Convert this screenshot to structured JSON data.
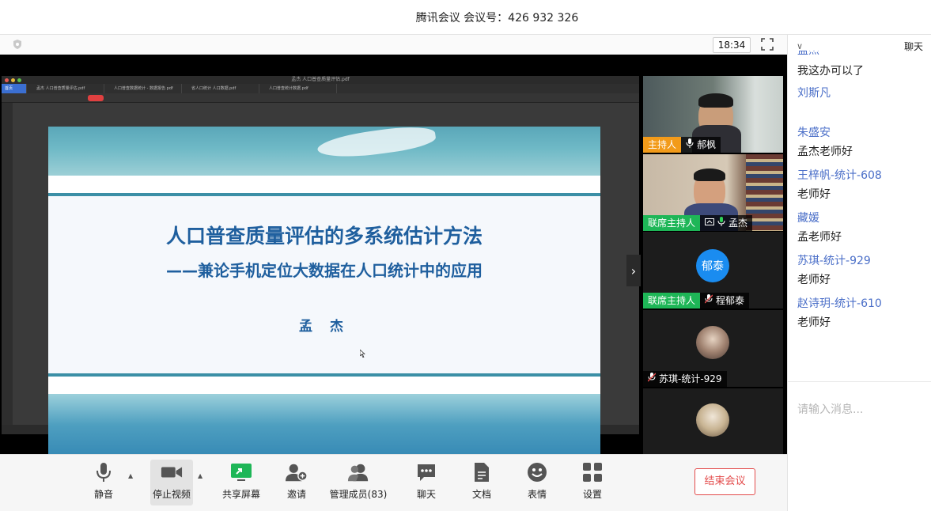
{
  "window": {
    "title": "腾讯会议  会议号：426 932 326"
  },
  "meeting": {
    "timer": "18:34"
  },
  "slide": {
    "title": "人口普查质量评估的多系统估计方法",
    "subtitle": "——兼论手机定位大数据在人口统计中的应用",
    "author": "孟 杰"
  },
  "pdf_viewer": {
    "window_title": "孟杰 人口普查质量评估.pdf",
    "tabs": [
      "首页",
      "孟杰 人口普查质量评估.pdf",
      "人口普查数据统计 - 数据报告.pdf",
      "省人口统计 人口数据.pdf",
      "人口普查统计数据.pdf"
    ]
  },
  "participants": [
    {
      "role": "主持人",
      "name": "郝枫",
      "mic": "on",
      "video": "camera"
    },
    {
      "role": "联席主持人",
      "name": "孟杰",
      "mic": "on",
      "sharing": true,
      "video": "camera"
    },
    {
      "role": "联席主持人",
      "name": "程郁泰",
      "mic": "muted",
      "avatar_text": "郁泰",
      "avatar_color": "#1a8cf0"
    },
    {
      "role": "",
      "name": "苏琪-统计-929",
      "mic": "muted",
      "video": "avatar-photo"
    },
    {
      "role": "",
      "name": "",
      "mic": "",
      "video": "avatar-photo"
    }
  ],
  "toolbar": {
    "mute": "静音",
    "stop_video": "停止视频",
    "share_screen": "共享屏幕",
    "invite": "邀请",
    "manage_members": "管理成员(83)",
    "chat": "聊天",
    "documents": "文档",
    "reactions": "表情",
    "settings": "设置",
    "end_meeting": "结束会议"
  },
  "chat": {
    "header": "聊天",
    "messages": [
      {
        "name": "孟杰",
        "text": "我这办可以了"
      },
      {
        "name": "刘斯凡",
        "text": ""
      },
      {
        "name": "朱盛安",
        "text": "孟杰老师好"
      },
      {
        "name": "王梓帆-统计-608",
        "text": "老师好"
      },
      {
        "name": "藏媛",
        "text": "孟老师好"
      },
      {
        "name": "苏琪-统计-929",
        "text": "老师好"
      },
      {
        "name": "赵诗玥-统计-610",
        "text": "老师好"
      }
    ],
    "input_placeholder": "请输入消息..."
  },
  "colors": {
    "accent": "#4b6fc8",
    "host": "#f29b1a",
    "cohost": "#1eb657",
    "end": "#e34b4b",
    "slide_title": "#1f5f9e"
  },
  "icons": [
    "shield-icon",
    "fullscreen-icon",
    "next-page-icon",
    "mic-icon",
    "camera-icon",
    "share-screen-icon",
    "add-user-icon",
    "members-icon",
    "chat-icon",
    "document-icon",
    "emoji-icon",
    "settings-icon",
    "chevron-down-icon"
  ]
}
